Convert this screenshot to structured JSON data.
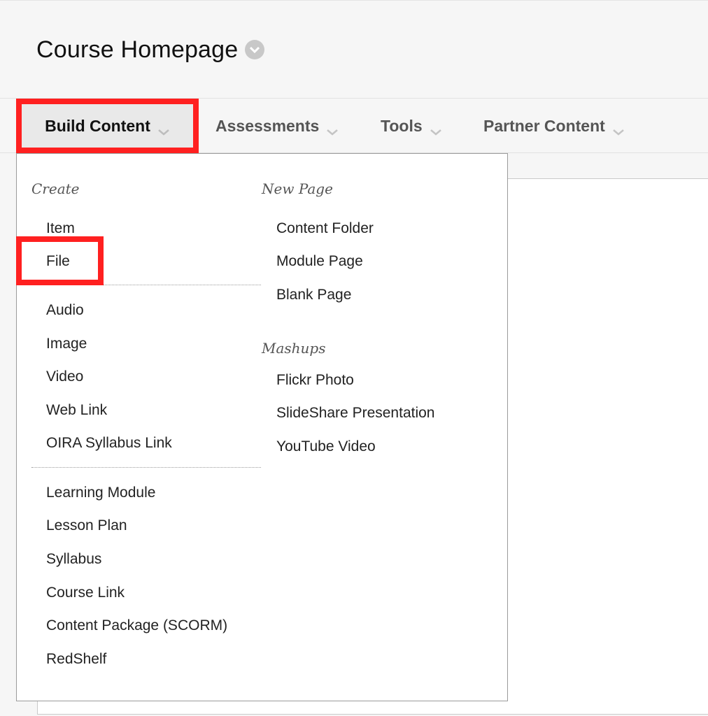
{
  "page": {
    "title": "Course Homepage"
  },
  "toolbar": {
    "items": [
      {
        "label": "Build Content"
      },
      {
        "label": "Assessments"
      },
      {
        "label": "Tools"
      },
      {
        "label": "Partner Content"
      }
    ]
  },
  "menu": {
    "create": {
      "heading": "Create",
      "items": [
        "Item",
        "File",
        "Audio",
        "Image",
        "Video",
        "Web Link",
        "OIRA Syllabus Link",
        "Learning Module",
        "Lesson Plan",
        "Syllabus",
        "Course Link",
        "Content Package (SCORM)",
        "RedShelf"
      ]
    },
    "new_page": {
      "heading": "New Page",
      "items": [
        "Content Folder",
        "Module Page",
        "Blank Page"
      ]
    },
    "mashups": {
      "heading": "Mashups",
      "items": [
        "Flickr Photo",
        "SlideShare Presentation",
        "YouTube Video"
      ]
    }
  },
  "colors": {
    "highlight": "#ff2020",
    "background": "#f6f6f6",
    "menu_background": "#ffffff"
  }
}
